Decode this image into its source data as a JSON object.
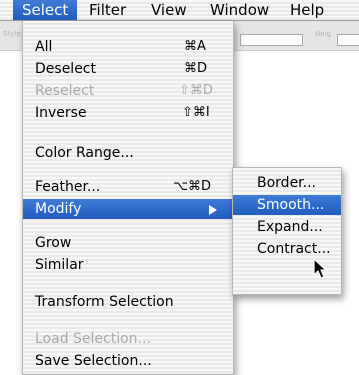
{
  "menubar": {
    "items": [
      {
        "label": "Select"
      },
      {
        "label": "Filter"
      },
      {
        "label": "View"
      },
      {
        "label": "Window"
      },
      {
        "label": "Help"
      }
    ]
  },
  "options_bar": {
    "style_label": "Style: Normal",
    "height_label": "Heig"
  },
  "select_menu": {
    "all": {
      "label": "All",
      "shortcut": "⌘A"
    },
    "deselect": {
      "label": "Deselect",
      "shortcut": "⌘D"
    },
    "reselect": {
      "label": "Reselect",
      "shortcut": "⇧⌘D"
    },
    "inverse": {
      "label": "Inverse",
      "shortcut": "⇧⌘I"
    },
    "color_range": {
      "label": "Color Range..."
    },
    "feather": {
      "label": "Feather...",
      "shortcut": "⌥⌘D"
    },
    "modify": {
      "label": "Modify"
    },
    "grow": {
      "label": "Grow"
    },
    "similar": {
      "label": "Similar"
    },
    "transform_selection": {
      "label": "Transform Selection"
    },
    "load_selection": {
      "label": "Load Selection..."
    },
    "save_selection": {
      "label": "Save Selection..."
    }
  },
  "modify_menu": {
    "border": {
      "label": "Border..."
    },
    "smooth": {
      "label": "Smooth..."
    },
    "expand": {
      "label": "Expand..."
    },
    "contract": {
      "label": "Contract..."
    }
  },
  "icons": {
    "submenu_arrow": "triangle-right-icon",
    "cursor": "mouse-pointer-icon"
  },
  "colors": {
    "highlight": "#2f6ccb",
    "disabled_text": "#a8a8a8"
  }
}
